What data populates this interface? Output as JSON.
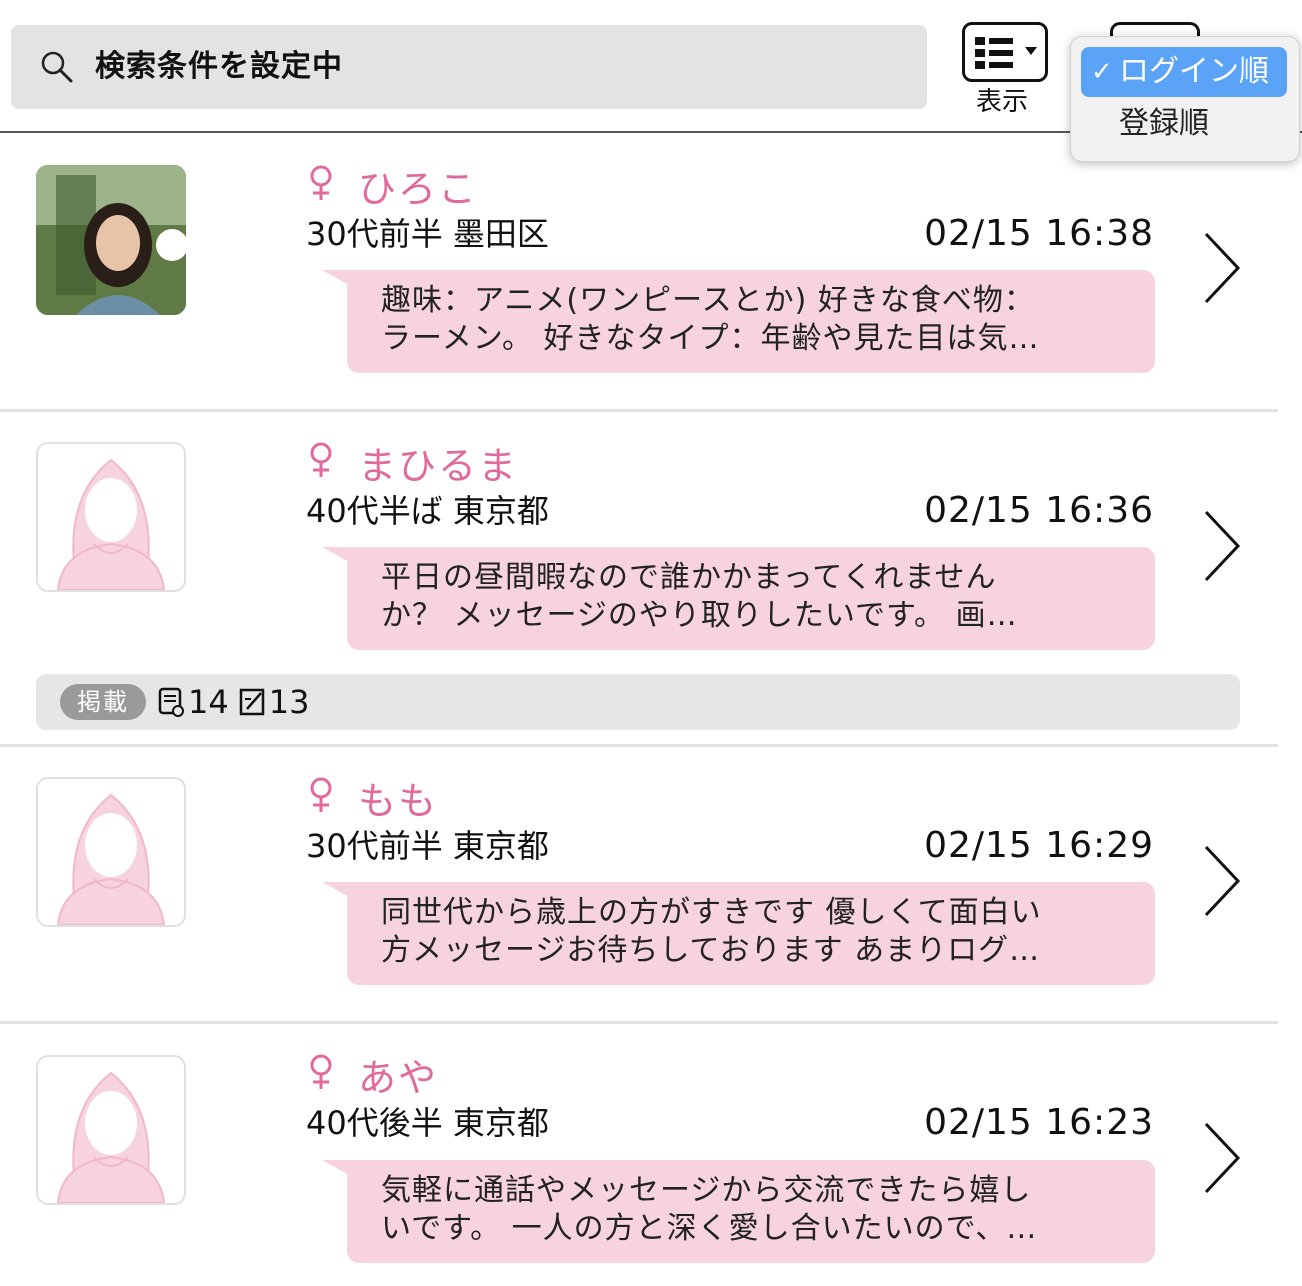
{
  "header": {
    "search_text": "検索条件を設定中",
    "view_label": "表示",
    "sort_menu": {
      "options": [
        {
          "label": "ログイン順",
          "selected": true
        },
        {
          "label": "登録順",
          "selected": false
        }
      ]
    }
  },
  "colors": {
    "accent_pink": "#e06a9c",
    "bubble_bg": "#f6d3de",
    "selected_blue": "#5ba3f6"
  },
  "users": [
    {
      "name": "ひろこ",
      "meta": "30代前半 墨田区",
      "time": "02/15 16:38",
      "message_line1": "趣味：アニメ(ワンピースとか) 好きな食べ物：",
      "message_line2": "ラーメン。 好きなタイプ：年齢や見た目は気…",
      "avatar": "photo"
    },
    {
      "name": "まひるま",
      "meta": "40代半ば 東京都",
      "time": "02/15 16:36",
      "message_line1": "平日の昼間暇なので誰かかまってくれません",
      "message_line2": "か？ メッセージのやり取りしたいです。 画…",
      "avatar": "placeholder"
    },
    {
      "name": "もも",
      "meta": "30代前半 東京都",
      "time": "02/15 16:29",
      "message_line1": "同世代から歳上の方がすきです 優しくて面白い",
      "message_line2": "方メッセージお待ちしております あまりログ…",
      "avatar": "placeholder"
    },
    {
      "name": "あや",
      "meta": "40代後半 東京都",
      "time": "02/15 16:23",
      "message_line1": "気軽に通話やメッセージから交流できたら嬉し",
      "message_line2": "いです。 一人の方と深く愛し合いたいので、…",
      "avatar": "placeholder"
    }
  ],
  "posting_bar": {
    "badge": "掲載",
    "count1": "14",
    "count2": "13"
  }
}
